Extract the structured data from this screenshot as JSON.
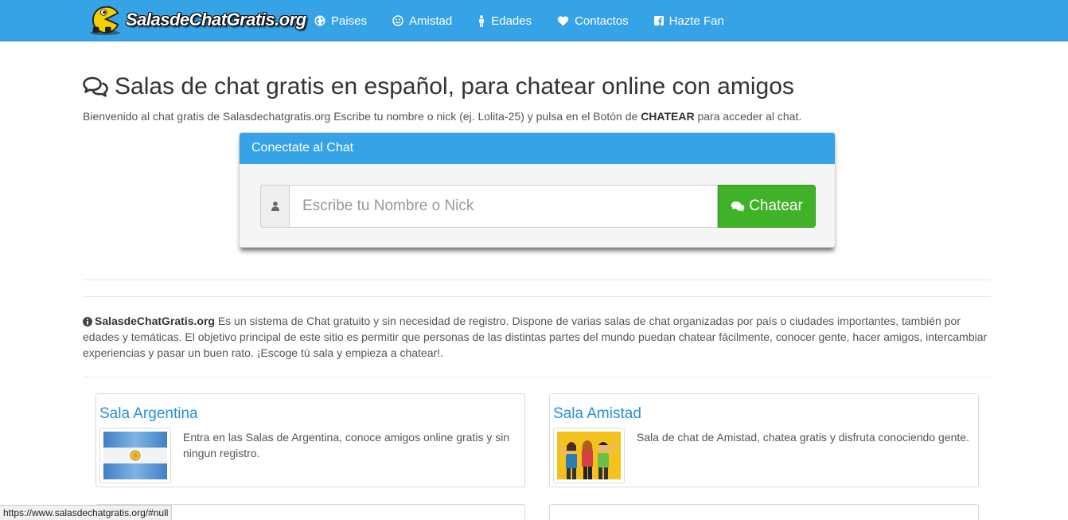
{
  "navbar": {
    "logo_text": "SalasdeChatGratis.org",
    "items": [
      {
        "label": "Paises",
        "icon": "globe-icon"
      },
      {
        "label": "Amistad",
        "icon": "smile-icon"
      },
      {
        "label": "Edades",
        "icon": "person-icon"
      },
      {
        "label": "Contactos",
        "icon": "heart-icon"
      },
      {
        "label": "Hazte Fan",
        "icon": "facebook-icon"
      }
    ],
    "color": "#36a3e6"
  },
  "header": {
    "title": "Salas de chat gratis en español, para chatear online con amigos",
    "intro_prefix": "Bienvenido al chat gratis de Salasdechatgratis.org Escribe tu nombre o nick (ej. Lolita-25) y pulsa en el Botón de",
    "intro_bold": "CHATEAR",
    "intro_suffix": "para acceder al chat."
  },
  "connect_panel": {
    "title": "Conectate al Chat",
    "input_placeholder": "Escribe tu Nombre o Nick",
    "button_label": "Chatear",
    "button_color": "#3fb227"
  },
  "about": {
    "site_name": "SalasdeChatGratis.org",
    "text": "Es un sistema de Chat gratuito y sin necesidad de registro. Dispone de varias salas de chat organizadas por país o ciudades importantes, también por edades y temáticas. El objetivo principal de este sitio es permitir que personas de las distintas partes del mundo puedan chatear fácilmente, conocer gente, hacer amigos, intercambiar experiencias y pasar un buen rato. ¡Escoge tú sala y empieza a chatear!."
  },
  "rooms": [
    {
      "title": "Sala Argentina",
      "description": "Entra en las Salas de Argentina, conoce amigos online gratis y sin ningun registro."
    },
    {
      "title": "Sala Amistad",
      "description": "Sala de chat de Amistad, chatea gratis y disfruta conociendo gente."
    }
  ],
  "status_bar": {
    "url": "https://www.salasdechatgratis.org/#null"
  }
}
